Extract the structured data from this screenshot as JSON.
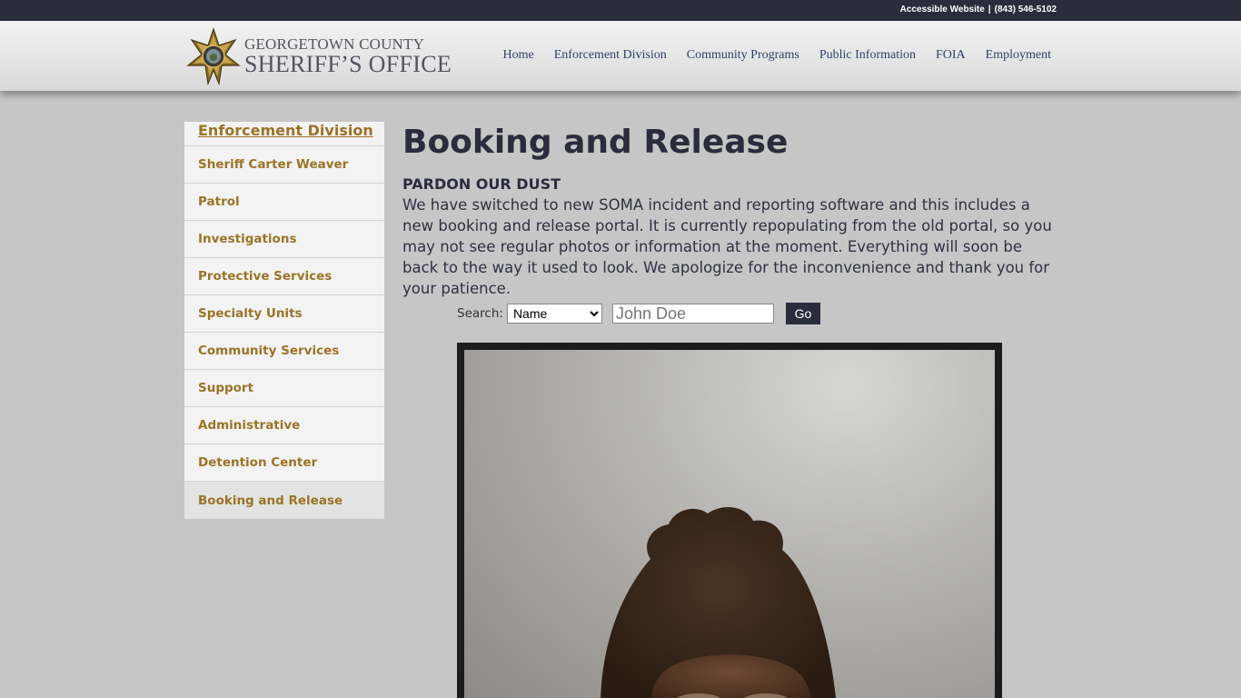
{
  "topbar": {
    "accessible_label": "Accessible Website",
    "separator": "|",
    "phone": "(843) 546-5102"
  },
  "logo": {
    "line1": "GEORGETOWN COUNTY",
    "line2": "SHERIFF’S OFFICE"
  },
  "nav": {
    "items": [
      {
        "label": "Home"
      },
      {
        "label": "Enforcement Division"
      },
      {
        "label": "Community Programs"
      },
      {
        "label": "Public Information"
      },
      {
        "label": "FOIA"
      },
      {
        "label": "Employment"
      }
    ]
  },
  "sidebar": {
    "heading": "Enforcement Division",
    "items": [
      {
        "label": "Sheriff Carter Weaver"
      },
      {
        "label": "Patrol"
      },
      {
        "label": "Investigations"
      },
      {
        "label": "Protective Services"
      },
      {
        "label": "Specialty Units"
      },
      {
        "label": "Community Services"
      },
      {
        "label": "Support"
      },
      {
        "label": "Administrative"
      },
      {
        "label": "Detention Center"
      },
      {
        "label": "Booking and Release"
      }
    ]
  },
  "main": {
    "title": "Booking and Release",
    "notice_heading": "PARDON OUR DUST",
    "notice_body": "We have switched to new SOMA incident and reporting software and this includes a new booking and release portal. It is currently repopulating from the old portal, so you may not see regular photos or information at the moment. Everything will soon be back to the way it used to look. We apologize for the inconvenience and thank you for your patience."
  },
  "search": {
    "label": "Search:",
    "selected_option": "Name",
    "placeholder": "John Doe",
    "button_label": "Go"
  },
  "colors": {
    "topbar": "#2b2d3d",
    "accent_gold": "#9b7326",
    "nav_link": "#2f3f6a",
    "page_bg": "#c6c6c6"
  }
}
